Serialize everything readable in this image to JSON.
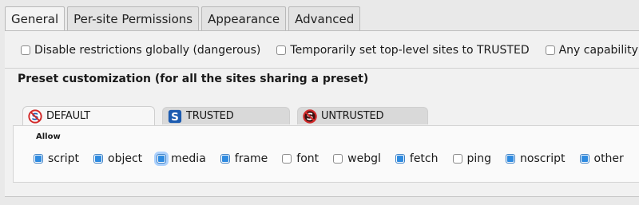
{
  "tabs": [
    "General",
    "Per-site Permissions",
    "Appearance",
    "Advanced"
  ],
  "active_tab": "General",
  "options": {
    "disable_restrictions": {
      "label": "Disable restrictions globally (dangerous)",
      "checked": false
    },
    "temp_trusted": {
      "label": "Temporarily set top-level sites to TRUSTED",
      "checked": false
    },
    "any_capability": {
      "label": "Any capability blo",
      "checked": false
    }
  },
  "preset_heading": "Preset customization (for all the sites sharing a preset)",
  "presets": {
    "default": {
      "label": "DEFAULT",
      "icon": "noscript-default-icon"
    },
    "trusted": {
      "label": "TRUSTED",
      "icon": "noscript-trusted-icon"
    },
    "untrusted": {
      "label": "UNTRUSTED",
      "icon": "noscript-untrusted-icon"
    }
  },
  "active_preset": "default",
  "allow_label": "Allow",
  "capabilities": [
    {
      "label": "script",
      "checked": true
    },
    {
      "label": "object",
      "checked": true
    },
    {
      "label": "media",
      "checked": true,
      "focused": true
    },
    {
      "label": "frame",
      "checked": true
    },
    {
      "label": "font",
      "checked": false
    },
    {
      "label": "webgl",
      "checked": false
    },
    {
      "label": "fetch",
      "checked": true
    },
    {
      "label": "ping",
      "checked": false
    },
    {
      "label": "noscript",
      "checked": true
    },
    {
      "label": "other",
      "checked": true
    }
  ],
  "colors": {
    "check_fill": "#2f8be0",
    "noscript_red": "#d22b2b",
    "noscript_blue": "#1c5bb0"
  }
}
